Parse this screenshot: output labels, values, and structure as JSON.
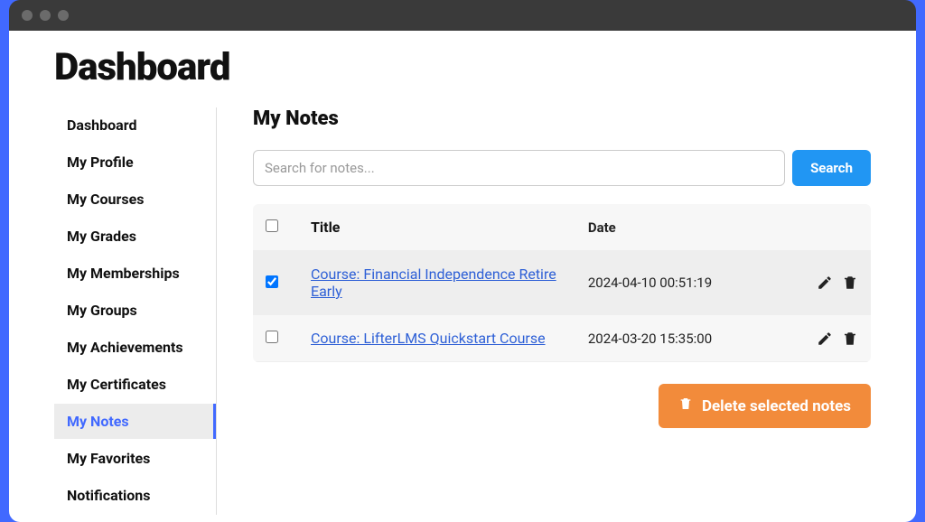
{
  "page_title": "Dashboard",
  "sidebar": {
    "items": [
      {
        "label": "Dashboard",
        "active": false
      },
      {
        "label": "My Profile",
        "active": false
      },
      {
        "label": "My Courses",
        "active": false
      },
      {
        "label": "My Grades",
        "active": false
      },
      {
        "label": "My Memberships",
        "active": false
      },
      {
        "label": "My Groups",
        "active": false
      },
      {
        "label": "My Achievements",
        "active": false
      },
      {
        "label": "My Certificates",
        "active": false
      },
      {
        "label": "My Notes",
        "active": true
      },
      {
        "label": "My Favorites",
        "active": false
      },
      {
        "label": "Notifications",
        "active": false
      }
    ]
  },
  "main": {
    "section_title": "My Notes",
    "search": {
      "placeholder": "Search for notes...",
      "button_label": "Search"
    },
    "table": {
      "headers": {
        "title": "Title",
        "date": "Date"
      },
      "rows": [
        {
          "checked": true,
          "title": "Course: Financial Independence Retire Early",
          "date": "2024-04-10 00:51:19"
        },
        {
          "checked": false,
          "title": "Course: LifterLMS Quickstart Course",
          "date": "2024-03-20 15:35:00"
        }
      ]
    },
    "delete_button_label": "Delete selected notes"
  }
}
